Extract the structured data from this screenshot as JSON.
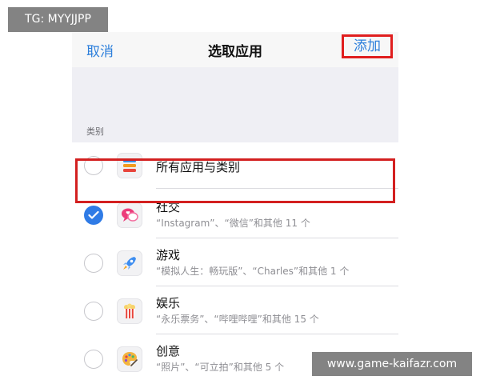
{
  "watermarks": {
    "top_left": "TG: MYYJJPP",
    "bottom_right": "www.game-kaifazr.com"
  },
  "navbar": {
    "cancel_label": "取消",
    "title": "选取应用",
    "add_label": "添加"
  },
  "section": {
    "header": "类别"
  },
  "categories": [
    {
      "title": "所有应用与类别",
      "subtitle": "",
      "selected": false,
      "icon": "stack-icon"
    },
    {
      "title": "社交",
      "subtitle": "“Instagram”、“微信”和其他 11 个",
      "selected": true,
      "icon": "chat-bubbles-icon"
    },
    {
      "title": "游戏",
      "subtitle": "“模拟人生：畅玩版”、“Charles”和其他 1 个",
      "selected": false,
      "icon": "rocket-icon"
    },
    {
      "title": "娱乐",
      "subtitle": "“永乐票务”、“哔哩哔哩”和其他 15 个",
      "selected": false,
      "icon": "popcorn-icon"
    },
    {
      "title": "创意",
      "subtitle": "“照片”、“可立拍”和其他 5 个",
      "selected": false,
      "icon": "palette-icon"
    }
  ],
  "colors": {
    "accent": "#2f7be6",
    "link": "#2d7fdb",
    "highlight": "#d32020"
  }
}
